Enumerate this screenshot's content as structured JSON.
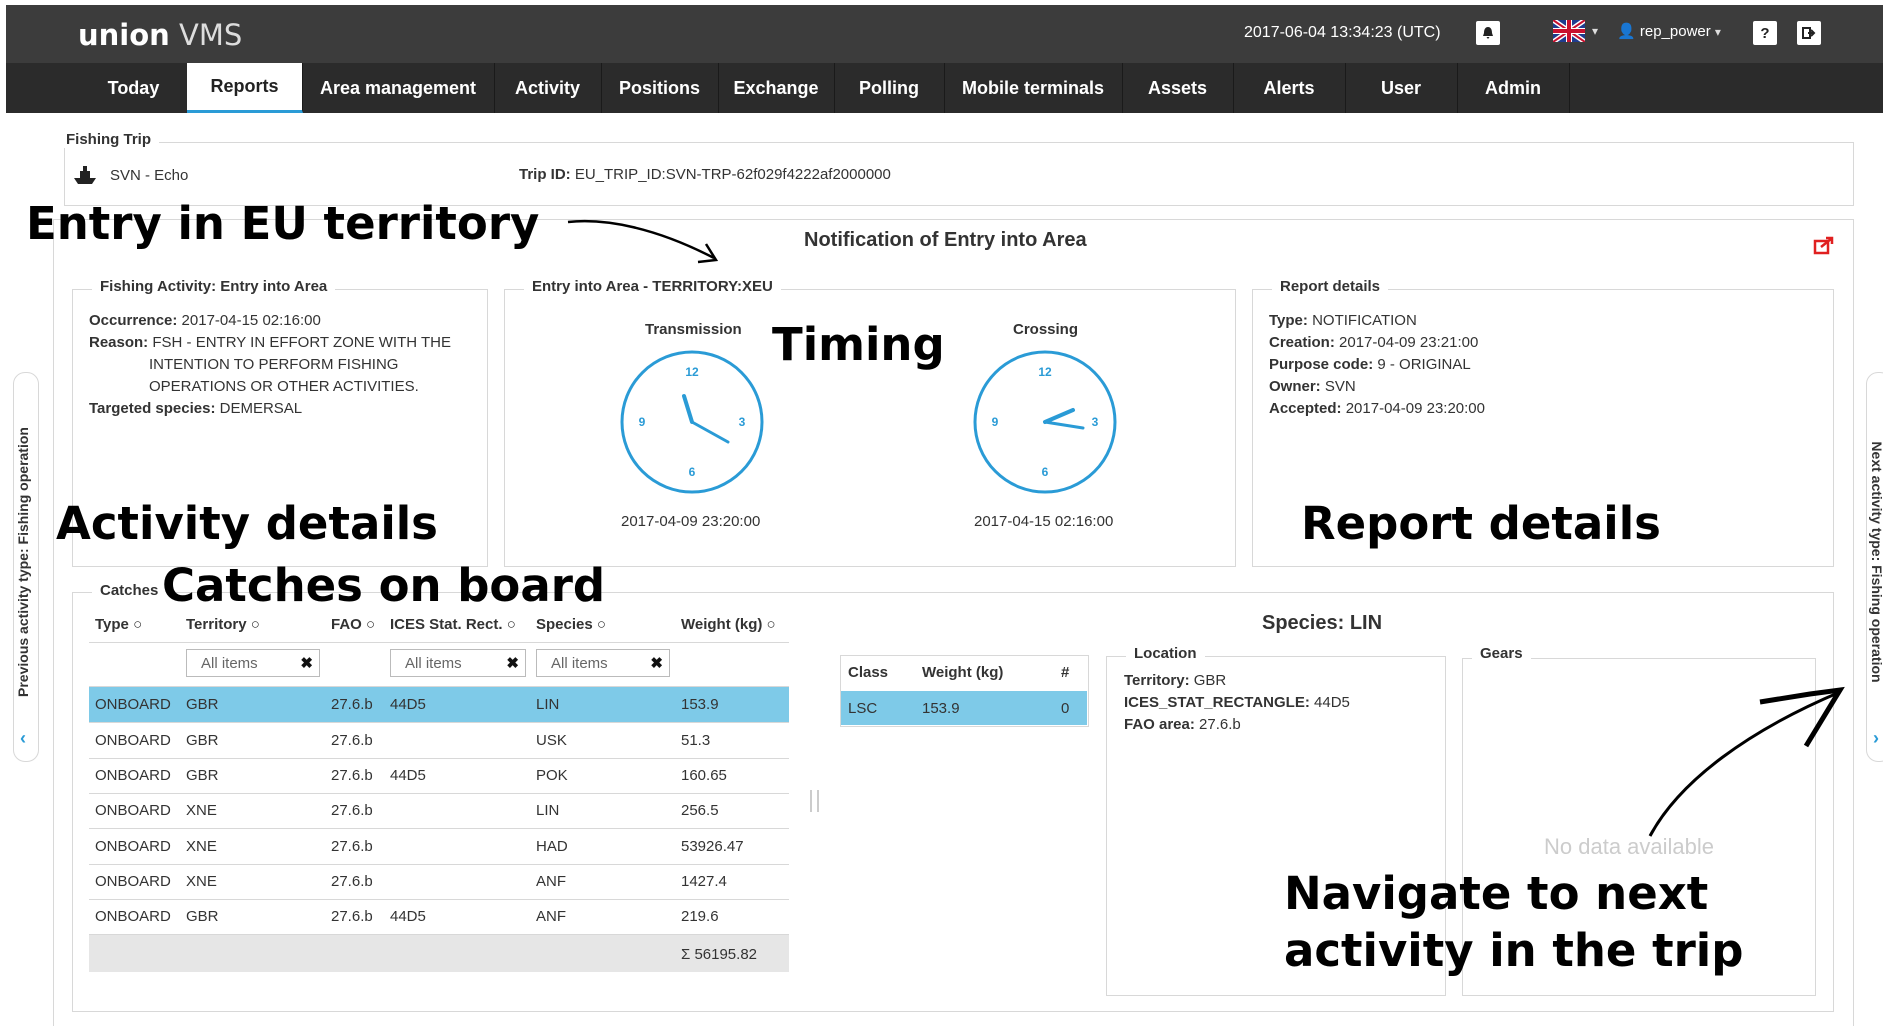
{
  "app": {
    "brand_bold": "union",
    "brand_light": " VMS",
    "datetime": "2017-06-04 13:34:23 (UTC)",
    "user": "rep_power"
  },
  "nav": [
    "Today",
    "Reports",
    "Area management",
    "Activity",
    "Positions",
    "Exchange",
    "Polling",
    "Mobile terminals",
    "Assets",
    "Alerts",
    "User",
    "Admin"
  ],
  "trip": {
    "legend": "Fishing Trip",
    "vessel": "SVN - Echo",
    "trip_id_label": "Trip ID:",
    "trip_id": "EU_TRIP_ID:SVN-TRP-62f029f4222af2000000"
  },
  "panel_title": "Notification of Entry into Area",
  "activity": {
    "legend": "Fishing Activity: Entry into Area",
    "occurrence_label": "Occurrence:",
    "occurrence": "2017-04-15 02:16:00",
    "reason_label": "Reason:",
    "reason_1": "FSH - ENTRY IN EFFORT ZONE WITH THE",
    "reason_2": "INTENTION TO PERFORM FISHING",
    "reason_3": "OPERATIONS OR OTHER ACTIVITIES.",
    "species_label": "Targeted species:",
    "species": "DEMERSAL"
  },
  "entry": {
    "legend": "Entry into Area - TERRITORY:XEU",
    "transmission_label": "Transmission",
    "transmission_time": "2017-04-09 23:20:00",
    "crossing_label": "Crossing",
    "crossing_time": "2017-04-15 02:16:00",
    "clock_numbers": [
      "12",
      "3",
      "6",
      "9"
    ]
  },
  "report": {
    "legend": "Report details",
    "type_label": "Type:",
    "type": "NOTIFICATION",
    "creation_label": "Creation:",
    "creation": "2017-04-09 23:21:00",
    "purpose_label": "Purpose code:",
    "purpose": "9 - ORIGINAL",
    "owner_label": "Owner:",
    "owner": "SVN",
    "accepted_label": "Accepted:",
    "accepted": "2017-04-09 23:20:00"
  },
  "catches": {
    "legend": "Catches",
    "headers": [
      "Type",
      "Territory",
      "FAO",
      "ICES Stat. Rect.",
      "Species",
      "Weight (kg)"
    ],
    "filter_placeholder": "All items",
    "rows": [
      [
        "ONBOARD",
        "GBR",
        "27.6.b",
        "44D5",
        "LIN",
        "153.9"
      ],
      [
        "ONBOARD",
        "GBR",
        "27.6.b",
        "",
        "USK",
        "51.3"
      ],
      [
        "ONBOARD",
        "GBR",
        "27.6.b",
        "44D5",
        "POK",
        "160.65"
      ],
      [
        "ONBOARD",
        "XNE",
        "27.6.b",
        "",
        "LIN",
        "256.5"
      ],
      [
        "ONBOARD",
        "XNE",
        "27.6.b",
        "",
        "HAD",
        "53926.47"
      ],
      [
        "ONBOARD",
        "XNE",
        "27.6.b",
        "",
        "ANF",
        "1427.4"
      ],
      [
        "ONBOARD",
        "GBR",
        "27.6.b",
        "44D5",
        "ANF",
        "219.6"
      ]
    ],
    "total": "Σ 56195.82"
  },
  "species_panel": {
    "title": "Species: LIN",
    "class_headers": [
      "Class",
      "Weight (kg)",
      "#"
    ],
    "class_row": [
      "LSC",
      "153.9",
      "0"
    ],
    "location_legend": "Location",
    "territory_label": "Territory:",
    "territory": "GBR",
    "ices_label": "ICES_STAT_RECTANGLE:",
    "ices": "44D5",
    "fao_label": "FAO area:",
    "fao": "27.6.b",
    "gears_legend": "Gears",
    "no_data": "No data available"
  },
  "side_nav": {
    "previous": "Previous activity type: Fishing operation",
    "next": "Next activity type: Fishing operation"
  },
  "annotations": {
    "entry": "Entry in EU territory",
    "timing": "Timing",
    "activity": "Activity details",
    "catches": "Catches on board",
    "report": "Report details",
    "navigate_1": "Navigate to next",
    "navigate_2": "activity in the trip"
  },
  "colors": {
    "accent": "#2a9bd6",
    "selected_row": "#7ecae8",
    "clock": "#2a9bd6",
    "export_icon": "#e02020"
  },
  "icons": [
    "bell-icon",
    "flag-uk-icon",
    "user-icon",
    "help-icon",
    "logout-icon",
    "ship-icon",
    "export-icon",
    "chevron-left-icon",
    "chevron-right-icon"
  ]
}
